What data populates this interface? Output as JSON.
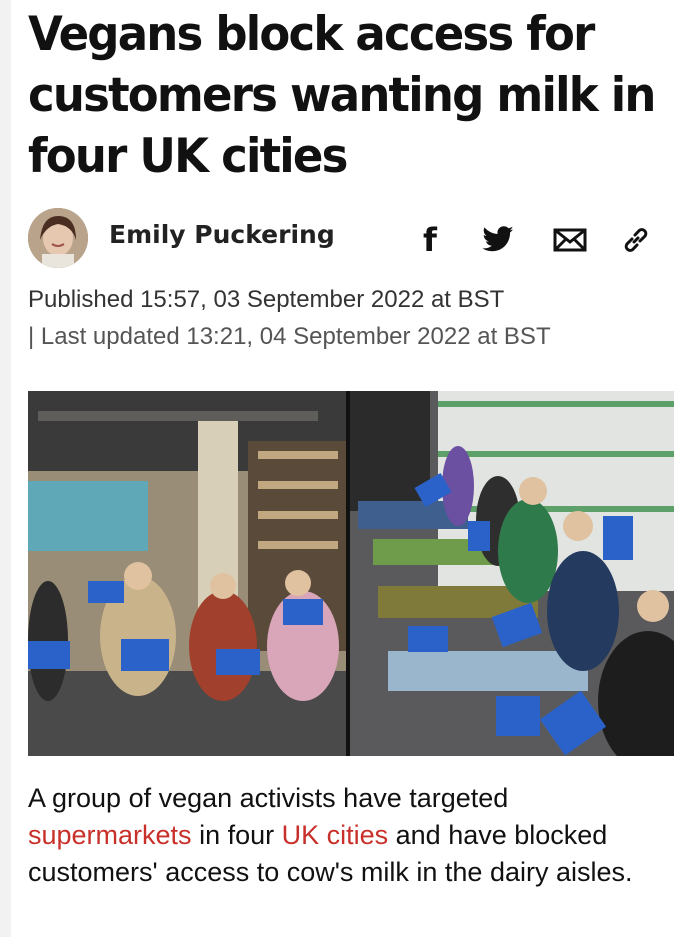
{
  "article": {
    "headline": "Vegans block access for customers wanting milk in four UK cities",
    "author": "Emily Puckering",
    "published": "Published 15:57, 03 September 2022 at BST",
    "updated": "| Last updated 13:21, 04 September 2022 at BST",
    "body": {
      "part1": "A group of vegan activists have targeted ",
      "link1": "supermarkets",
      "part2": " in four ",
      "link2": "UK cities",
      "part3": " and have blocked customers' access to cow's milk in the dairy aisles."
    }
  },
  "share": {
    "facebook_glyph": "f",
    "icons": [
      "facebook-icon",
      "twitter-icon",
      "email-icon",
      "link-icon"
    ]
  },
  "colors": {
    "link": "#c8302a",
    "sign_blue": "#2a62c9"
  }
}
